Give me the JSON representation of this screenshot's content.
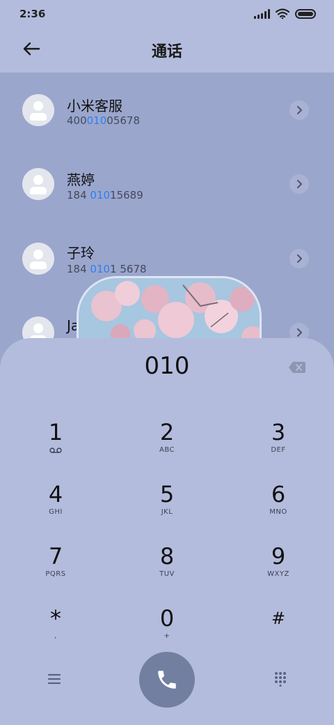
{
  "status_bar": {
    "time": "2:36"
  },
  "header": {
    "title": "通话",
    "back_icon": "arrow-left-icon"
  },
  "contacts": [
    {
      "name": "小米客服",
      "number_before": "400",
      "number_match": "010",
      "number_after": "05678"
    },
    {
      "name": "燕婷",
      "number_before": "184 ",
      "number_match": "010",
      "number_after": "15689"
    },
    {
      "name": "子玲",
      "number_before": "184 ",
      "number_match": "010",
      "number_after": "1 5678"
    },
    {
      "name": "Jason",
      "number_before": "",
      "number_match": "",
      "number_after": ""
    }
  ],
  "dialer": {
    "value": "010",
    "keys": [
      {
        "digit": "1",
        "sub": "voicemail-icon"
      },
      {
        "digit": "2",
        "sub": "ABC"
      },
      {
        "digit": "3",
        "sub": "DEF"
      },
      {
        "digit": "4",
        "sub": "GHI"
      },
      {
        "digit": "5",
        "sub": "JKL"
      },
      {
        "digit": "6",
        "sub": "MNO"
      },
      {
        "digit": "7",
        "sub": "PQRS"
      },
      {
        "digit": "8",
        "sub": "TUV"
      },
      {
        "digit": "9",
        "sub": "WXYZ"
      },
      {
        "digit": "*",
        "sub": ","
      },
      {
        "digit": "0",
        "sub": "+"
      },
      {
        "digit": "#",
        "sub": ""
      }
    ]
  },
  "colors": {
    "accent": "#2f7ff0",
    "call_button": "#737fa0",
    "sheet": "#b4bcdd",
    "list_bg": "#9ba6cd"
  }
}
